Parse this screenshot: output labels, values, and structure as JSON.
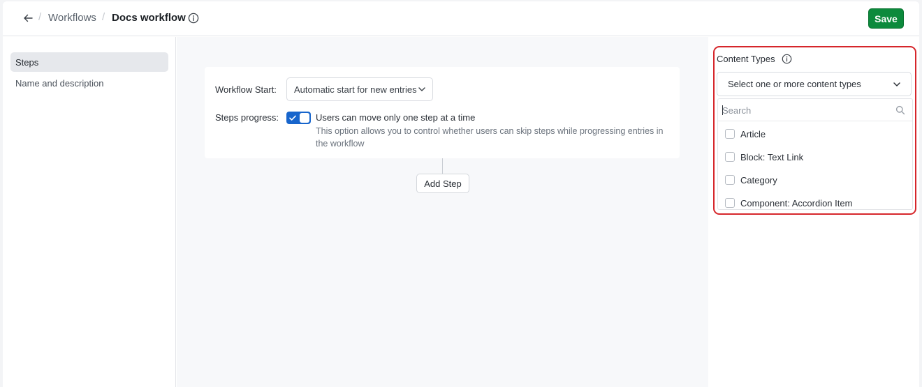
{
  "header": {
    "breadcrumb_parent": "Workflows",
    "breadcrumb_separator": "/",
    "title": "Docs workflow",
    "save_label": "Save",
    "icons": {
      "back": "arrow-left-icon",
      "info": "info-icon"
    }
  },
  "sidebar": {
    "items": [
      {
        "label": "Steps",
        "active": true
      },
      {
        "label": "Name and description",
        "active": false
      }
    ]
  },
  "workflow": {
    "start_label": "Workflow Start:",
    "start_value": "Automatic start for new entries",
    "progress_label": "Steps progress:",
    "progress_toggle_on": true,
    "progress_option_title": "Users can move only one step at a time",
    "progress_option_desc": "This option allows you to control whether users can skip steps while progressing entries in the workflow",
    "add_step_label": "Add Step"
  },
  "content_types": {
    "label": "Content Types",
    "select_placeholder": "Select one or more content types",
    "search_placeholder": "Search",
    "options": [
      {
        "label": "Article",
        "checked": false
      },
      {
        "label": "Block: Text Link",
        "checked": false
      },
      {
        "label": "Category",
        "checked": false
      },
      {
        "label": "Component: Accordion Item",
        "checked": false
      }
    ]
  },
  "colors": {
    "primary_green": "#0c8a3c",
    "toggle_blue": "#1765cc",
    "highlight_red": "#d6262b"
  }
}
